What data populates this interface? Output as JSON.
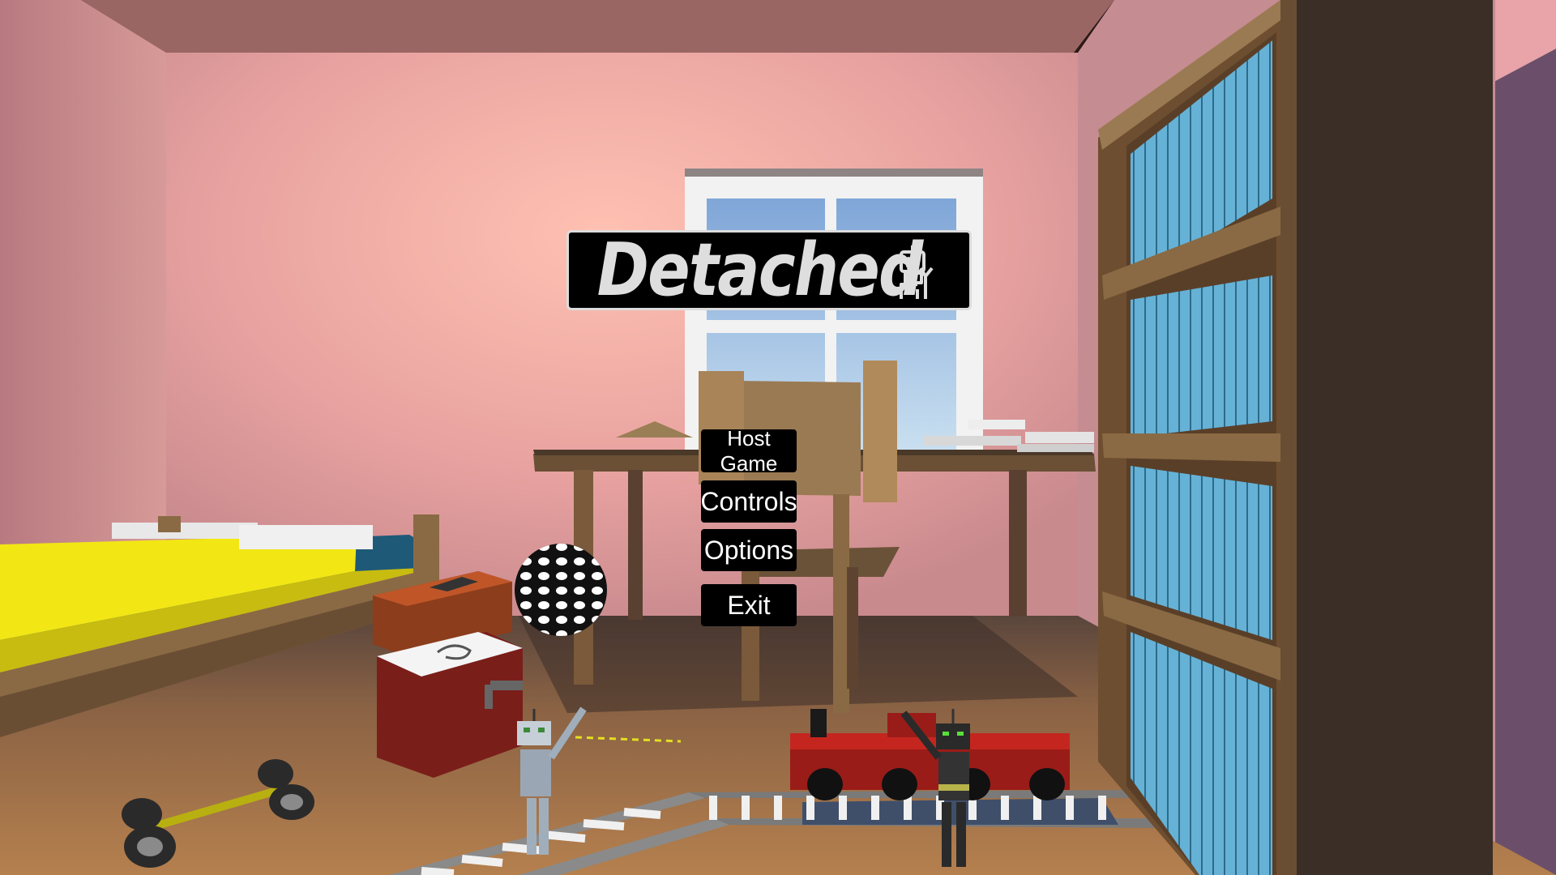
{
  "game": {
    "title": "Detached",
    "title_icon": "robot-icon"
  },
  "menu": {
    "host_game": "Host Game",
    "controls": "Controls",
    "options": "Options",
    "exit": "Exit"
  },
  "colors": {
    "wall": "#e8a8a4",
    "floor": "#a8754a",
    "button_bg": "#000000",
    "button_text": "#ffffff",
    "title_text": "#dedede",
    "bed_sheet": "#f2e615",
    "bed_frame": "#1e5a78",
    "book_blue": "#5fa8cc"
  }
}
